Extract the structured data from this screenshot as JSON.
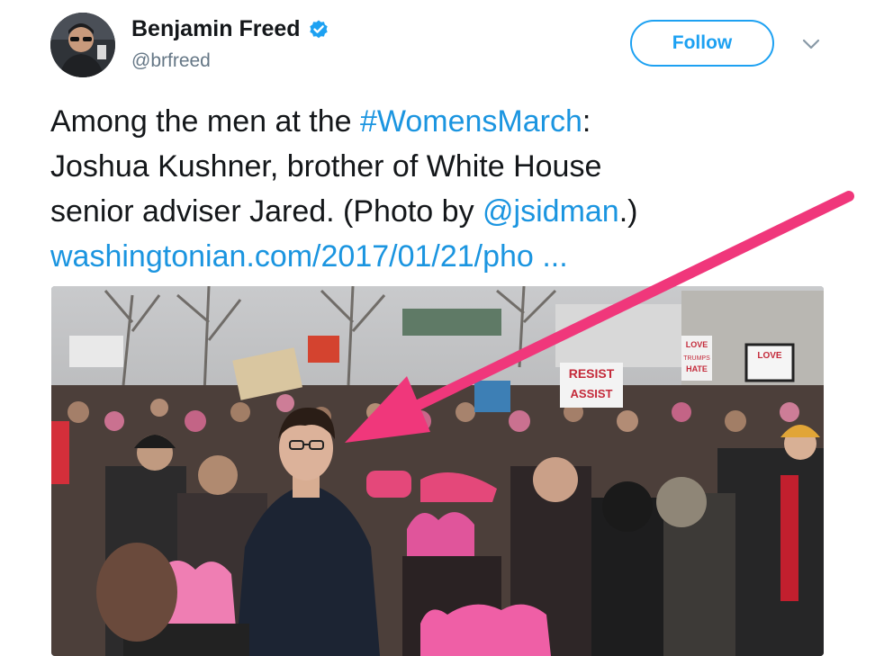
{
  "author": {
    "display_name": "Benjamin Freed",
    "handle": "@brfreed",
    "verified": true,
    "avatar_icon": "user-avatar"
  },
  "actions": {
    "follow_label": "Follow",
    "menu_icon": "chevron-down-icon"
  },
  "tweet": {
    "line1_text": "Among the men at the ",
    "hashtag": "#WomensMarch",
    "line1_end": ":",
    "line2": "Joshua Kushner, brother of White House",
    "line3_text": "senior adviser Jared. (Photo by ",
    "mention": "@jsidman",
    "line3_end": ".)",
    "link": "washingtonian.com/2017/01/21/pho",
    "link_ellipsis": "..."
  },
  "photo": {
    "signs": [
      "RESIST",
      "ASSIST",
      "LOVE",
      "TRUMPS",
      "HATE",
      "LOVE"
    ]
  },
  "colors": {
    "brand_blue": "#1da1f2",
    "link_blue": "#1b95e0",
    "arrow_pink": "#f0377b",
    "text_dark": "#14171a",
    "text_gray": "#657786"
  }
}
